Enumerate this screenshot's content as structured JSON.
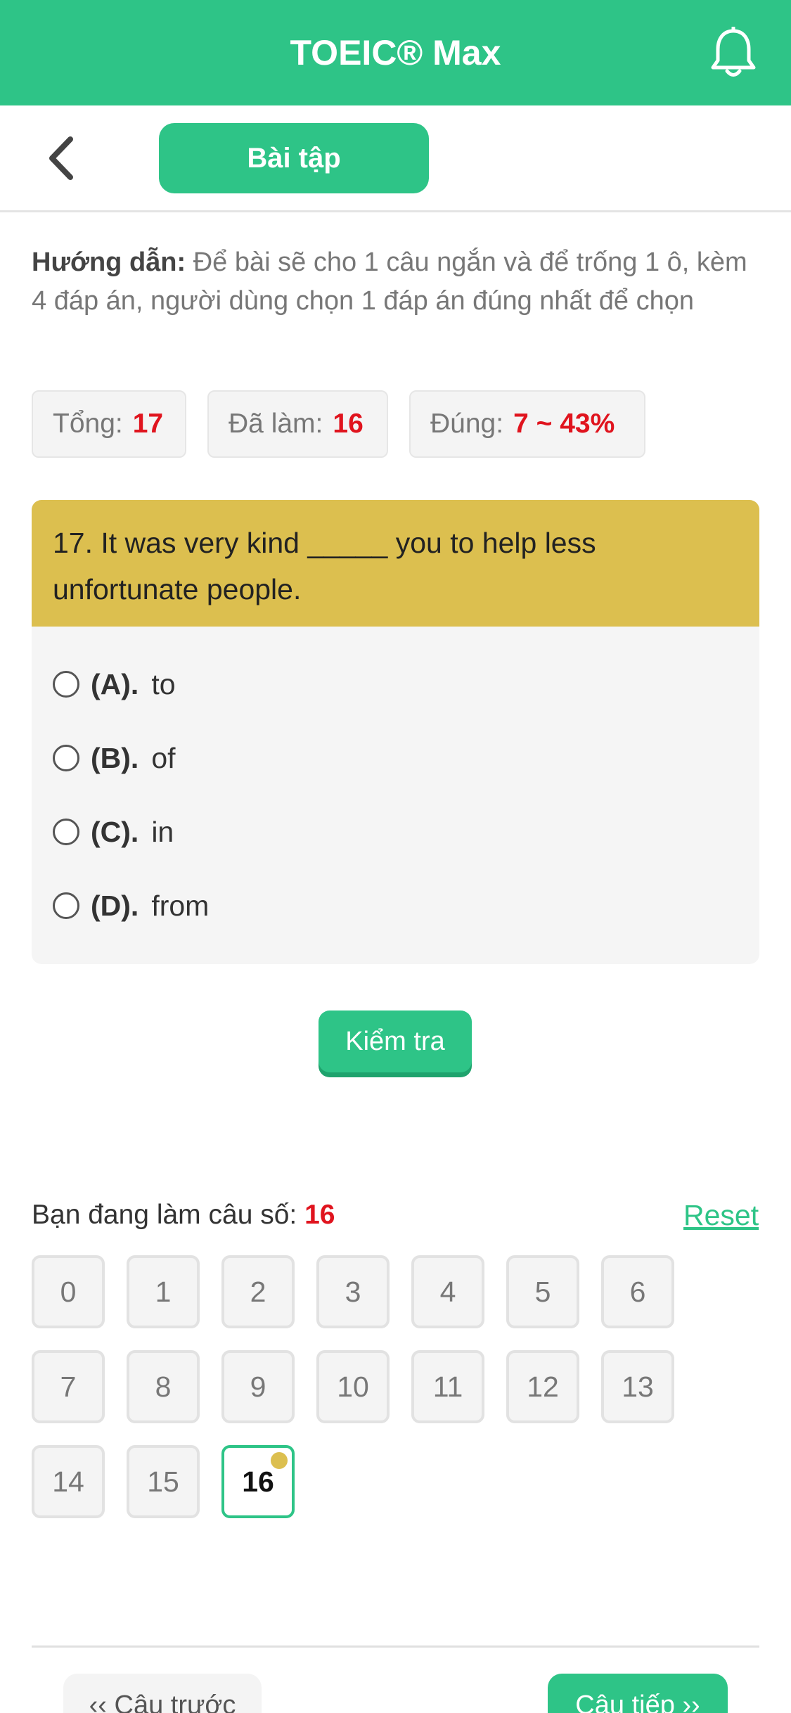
{
  "header": {
    "title": "TOEIC® Max",
    "bell_icon": "bell-icon"
  },
  "subbar": {
    "back_icon": "chevron-left-icon",
    "tab_label": "Bài tập"
  },
  "guide": {
    "label": "Hướng dẫn:",
    "text": "Để bài sẽ cho 1 câu ngắn và để trống 1 ô, kèm 4 đáp án, người dùng chọn 1 đáp án đúng nhất để chọn"
  },
  "stats": {
    "total_label": "Tổng:",
    "total_value": "17",
    "done_label": "Đã làm:",
    "done_value": "16",
    "correct_label": "Đúng:",
    "correct_value": "7 ~ 43%"
  },
  "question": {
    "text": "17. It was very kind _____ you to help less unfortunate people.",
    "options": [
      {
        "label": "(A).",
        "text": "to"
      },
      {
        "label": "(B).",
        "text": "of"
      },
      {
        "label": "(C).",
        "text": "in"
      },
      {
        "label": "(D).",
        "text": "from"
      }
    ]
  },
  "check_button": "Kiểm tra",
  "progress": {
    "current_label": "Bạn đang làm câu số:",
    "current_value": "16",
    "reset_label": "Reset",
    "numbers": [
      "0",
      "1",
      "2",
      "3",
      "4",
      "5",
      "6",
      "7",
      "8",
      "9",
      "10",
      "11",
      "12",
      "13",
      "14",
      "15",
      "16"
    ],
    "active": "16"
  },
  "nav": {
    "prev_label": "‹‹ Câu trước",
    "next_label": "Câu tiếp ››"
  },
  "colors": {
    "brand": "#2ec487",
    "question_header": "#dcbf4f",
    "highlight": "#e0141e"
  }
}
